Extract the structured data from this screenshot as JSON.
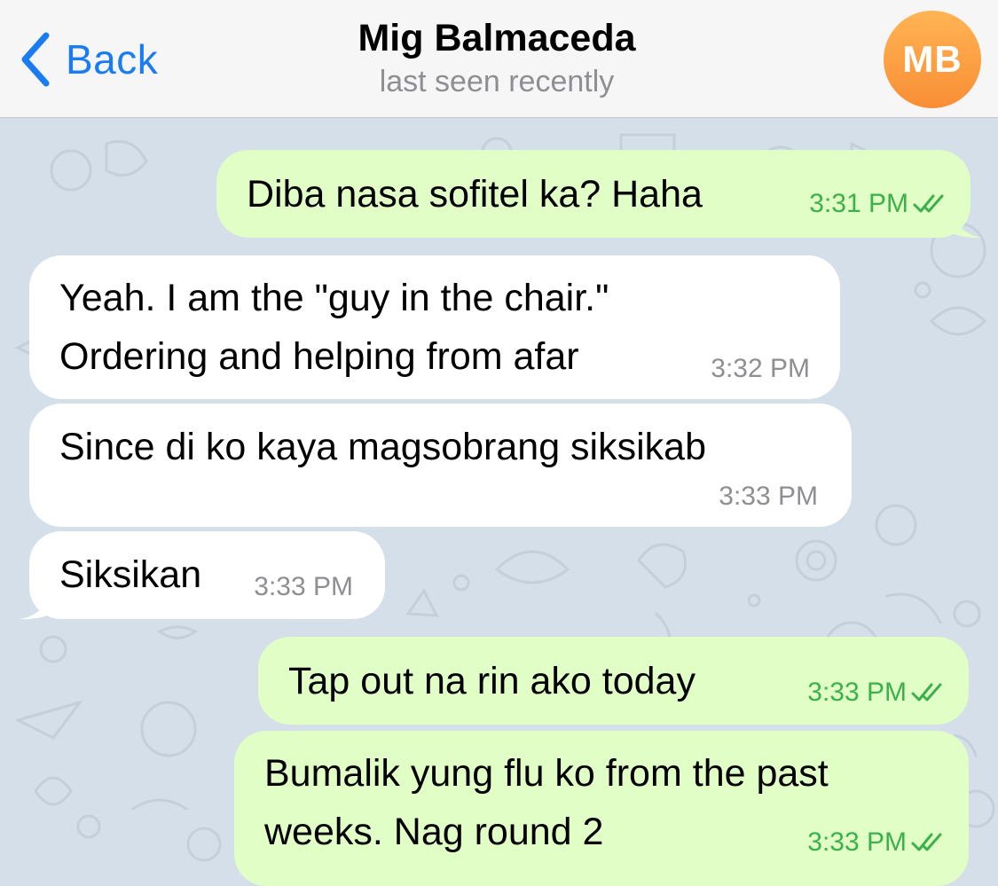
{
  "header": {
    "back_label": "Back",
    "contact_name": "Mig Balmaceda",
    "status": "last seen recently",
    "avatar_initials": "MB",
    "avatar_color": "#f98e35"
  },
  "colors": {
    "accent": "#1a7cf2",
    "outgoing_bubble": "#e1fec6",
    "incoming_bubble": "#ffffff",
    "outgoing_time": "#3cb04b",
    "incoming_time": "#8e8e93"
  },
  "messages": [
    {
      "direction": "out",
      "lines": [
        "Diba nasa sofitel ka? Haha"
      ],
      "time": "3:31 PM",
      "read": true
    },
    {
      "direction": "in",
      "lines": [
        "Yeah. I am the \"guy in the chair.\"",
        "Ordering and helping from afar"
      ],
      "time": "3:32 PM"
    },
    {
      "direction": "in",
      "lines": [
        "Since di ko kaya magsobrang siksikab"
      ],
      "time": "3:33 PM"
    },
    {
      "direction": "in",
      "lines": [
        "Siksikan"
      ],
      "time": "3:33 PM"
    },
    {
      "direction": "out",
      "lines": [
        "Tap out na rin ako today"
      ],
      "time": "3:33 PM",
      "read": true
    },
    {
      "direction": "out",
      "lines": [
        "Bumalik yung flu ko from the past",
        "weeks. Nag round 2"
      ],
      "time": "3:33 PM",
      "read": true
    }
  ]
}
